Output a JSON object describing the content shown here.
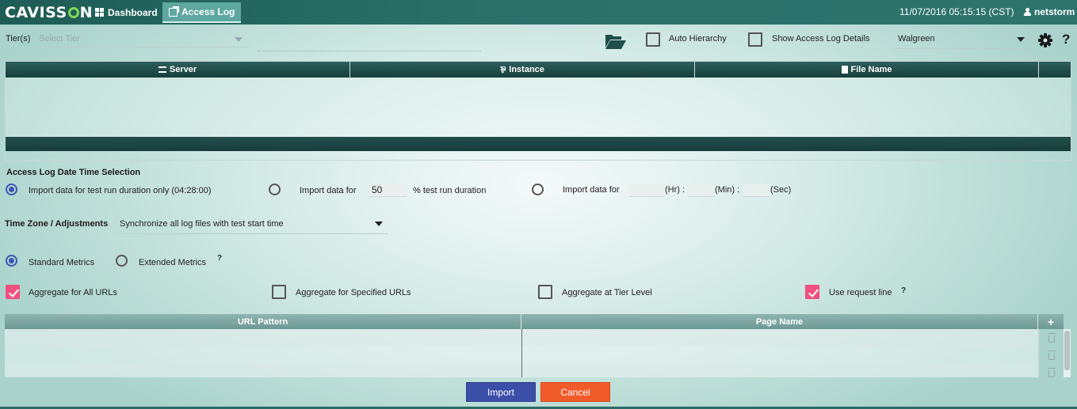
{
  "header": {
    "brand": "CAVISS",
    "brand_tail": "N",
    "nav_dashboard": "Dashboard",
    "nav_access_log": "Access Log",
    "datetime": "11/07/2016 05:15:15 (CST)",
    "user": "netstorm"
  },
  "toolbar": {
    "tier_label": "Tier(s)",
    "tier_placeholder": "Select Tier",
    "auto_hierarchy": "Auto Hierarchy",
    "show_details": "Show Access Log Details",
    "profile_value": "Walgreen",
    "help": "?"
  },
  "server_table": {
    "columns": [
      "Server",
      "Instance",
      "File Name"
    ]
  },
  "datetime_section": {
    "title": "Access Log Date Time Selection",
    "opt1": "Import data for test run duration only (04:28:00)",
    "opt2_prefix": "Import data for",
    "opt2_value": "50",
    "opt2_suffix": "% test run duration",
    "opt3_prefix": "Import data for",
    "hr": "(Hr) :",
    "min": "(Min) :",
    "sec": "(Sec)"
  },
  "timezone": {
    "label": "Time Zone / Adjustments",
    "value": "Synchronize all log files with test start time"
  },
  "metrics": {
    "standard": "Standard Metrics",
    "extended": "Extended Metrics",
    "help": "?"
  },
  "aggregate": {
    "all_urls": "Aggregate for All URLs",
    "specified": "Aggregate for Specified URLs",
    "tier_level": "Aggregate at Tier Level",
    "request_line": "Use request line",
    "help": "?"
  },
  "url_table": {
    "columns": [
      "URL Pattern",
      "Page Name"
    ],
    "add": "+"
  },
  "actions": {
    "import": "Import",
    "cancel": "Cancel"
  },
  "colors": {
    "topbar": "#2b716a",
    "accent_blue": "#3b4fa8",
    "cancel_orange": "#f15a29",
    "checked_pink": "#f0507f"
  }
}
